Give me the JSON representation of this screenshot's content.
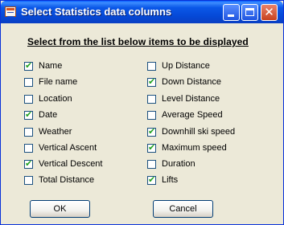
{
  "window": {
    "title": "Select Statistics data columns"
  },
  "heading": "Select from the list below items to be displayed",
  "left_items": [
    {
      "label": "Name",
      "checked": true
    },
    {
      "label": "File name",
      "checked": false
    },
    {
      "label": "Location",
      "checked": false
    },
    {
      "label": "Date",
      "checked": true
    },
    {
      "label": "Weather",
      "checked": false
    },
    {
      "label": "Vertical Ascent",
      "checked": false
    },
    {
      "label": "Vertical Descent",
      "checked": true
    },
    {
      "label": "Total Distance",
      "checked": false
    }
  ],
  "right_items": [
    {
      "label": "Up Distance",
      "checked": false
    },
    {
      "label": "Down Distance",
      "checked": true
    },
    {
      "label": "Level Distance",
      "checked": false
    },
    {
      "label": "Average Speed",
      "checked": false
    },
    {
      "label": "Downhill ski speed",
      "checked": true
    },
    {
      "label": "Maximum speed",
      "checked": true
    },
    {
      "label": "Duration",
      "checked": false
    },
    {
      "label": "Lifts",
      "checked": true
    }
  ],
  "buttons": {
    "ok": "OK",
    "cancel": "Cancel"
  },
  "icons": {
    "app": "statistics-app-icon",
    "minimize": "minimize-icon",
    "maximize": "maximize-icon",
    "close": "close-icon"
  },
  "colors": {
    "titlebar": "#0548d6",
    "close_button": "#c8421f",
    "check": "#21a121",
    "dialog_bg": "#ece9d8"
  }
}
